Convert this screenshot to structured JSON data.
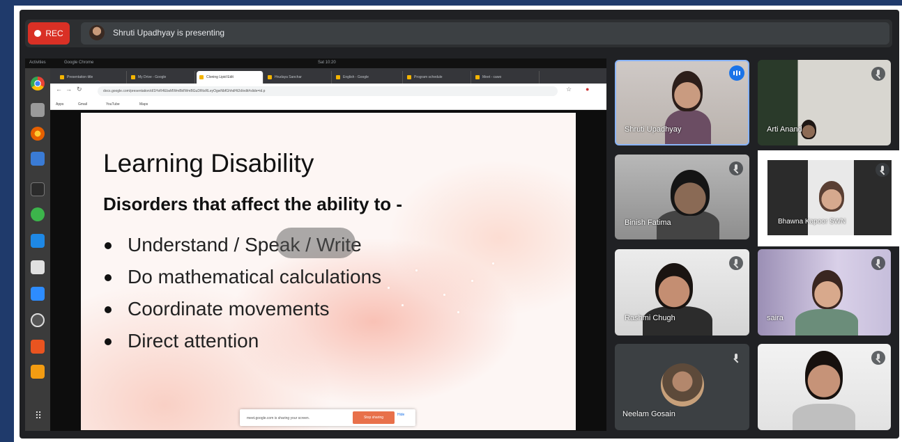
{
  "recording": {
    "label": "REC"
  },
  "presenter": {
    "text": "Shruti Upadhyay is presenting"
  },
  "shared_screen": {
    "os_topbar": {
      "activities": "Activities",
      "app": "Google Chrome",
      "clock": "Sat 10:20"
    },
    "browser": {
      "tabs": [
        {
          "label": "Presentation title",
          "active": false
        },
        {
          "label": "My Drive - Google",
          "active": false
        },
        {
          "label": "Cloning Lipid Edit",
          "active": true
        },
        {
          "label": "Hrudaya Sanchar",
          "active": false
        },
        {
          "label": "English - Google",
          "active": false
        },
        {
          "label": "Program schedule",
          "active": false
        },
        {
          "label": "Meet - cawo",
          "active": false
        }
      ],
      "url": "docs.google.com/presentation/d/1HvR4EbsMWmBkfWmBGuDRtsRLeyOgwNbfGhhdHt2d/edit#slide=id.p",
      "bookmarks": [
        "Apps",
        "Gmail",
        "YouTube",
        "Maps"
      ]
    },
    "slide": {
      "title": "Learning Disability",
      "subtitle": "Disorders that affect the ability to -",
      "bullets": [
        "Understand / Speak / Write",
        "Do mathematical calculations",
        "Coordinate movements",
        "Direct attention"
      ]
    },
    "share_notice": {
      "text": "meet.google.com is sharing your screen.",
      "stop_label": "Stop sharing",
      "hide_label": "Hide"
    }
  },
  "participants": [
    {
      "name": "Shruti Upadhyay",
      "status": "speaking"
    },
    {
      "name": "Arti Anand",
      "status": "muted"
    },
    {
      "name": "Binish Fatima",
      "status": "muted"
    },
    {
      "name": "Bhawna Kapoor SWN",
      "status": "muted"
    },
    {
      "name": "Rashmi Chugh",
      "status": "muted"
    },
    {
      "name": "saira",
      "status": "muted"
    },
    {
      "name": "Neelam Gosain",
      "status": "muted"
    },
    {
      "name": "",
      "status": "muted"
    }
  ],
  "icons": {
    "rec": "record-dot-icon",
    "mic_off": "mic-off-icon",
    "speaking": "audio-wave-icon",
    "browser": "chrome-icon",
    "apps": "grid-icon"
  },
  "colors": {
    "rec": "#d93025",
    "speaking": "#1a73e8",
    "meet_bg": "#202124",
    "stop": "#e8704a"
  }
}
